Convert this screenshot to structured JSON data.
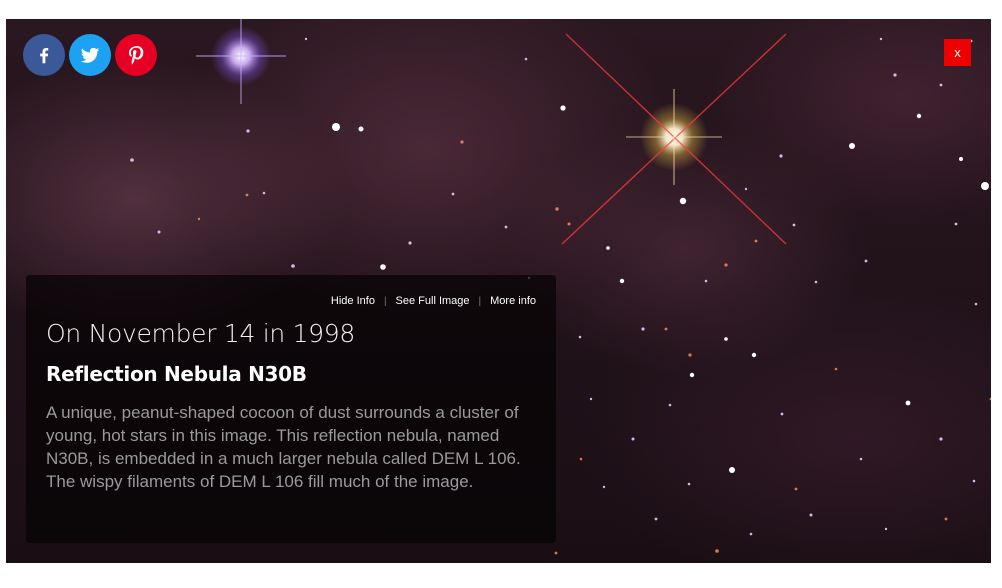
{
  "social": {
    "facebook": {
      "icon": "facebook-icon",
      "color": "#3b5998"
    },
    "twitter": {
      "icon": "twitter-icon",
      "color": "#1da1f2"
    },
    "pinterest": {
      "icon": "pinterest-icon",
      "color": "#e60023"
    }
  },
  "close_label": "x",
  "close_color": "#ee0000",
  "links": {
    "hide_info": "Hide Info",
    "see_full_image": "See Full Image",
    "more_info": "More info",
    "separator": "|"
  },
  "date_heading": "On November 14 in 1998",
  "title": "Reflection Nebula N30B",
  "description": "A unique, peanut-shaped cocoon of dust surrounds a cluster of young, hot stars in this image. This reflection nebula, named N30B, is embedded in a much larger nebula called DEM L 106. The wispy filaments of DEM L 106 fill much of the image."
}
